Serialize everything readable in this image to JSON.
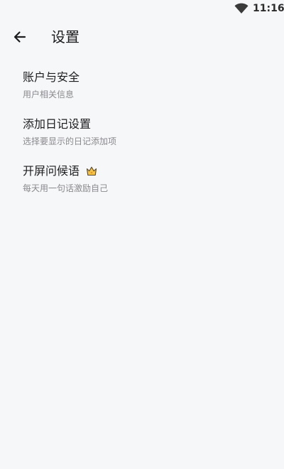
{
  "status_bar": {
    "time": "11:16",
    "wifi_icon": "wifi-icon"
  },
  "header": {
    "back_icon": "arrow-left-icon",
    "title": "设置"
  },
  "settings": {
    "items": [
      {
        "title": "账户与安全",
        "subtitle": "用户相关信息"
      },
      {
        "title": "添加日记设置",
        "subtitle": "选择要显示的日记添加项"
      },
      {
        "title": "开屏问候语",
        "subtitle": "每天用一句话激励自己",
        "badge_icon": "crown-icon"
      }
    ]
  },
  "colors": {
    "background": "#f6f7f9",
    "primary_text": "#1d1d1f",
    "secondary_text": "#8a8a8e",
    "crown_fill": "#f6c343"
  }
}
